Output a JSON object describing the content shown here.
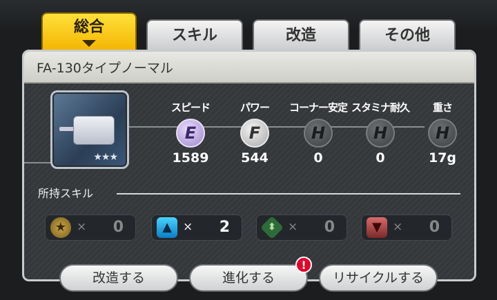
{
  "tabs": [
    {
      "label": "総合",
      "active": true
    },
    {
      "label": "スキル",
      "active": false
    },
    {
      "label": "改造",
      "active": false
    },
    {
      "label": "その他",
      "active": false
    }
  ],
  "part": {
    "name": "FA-130タイプノーマル",
    "rarity_stars": "★★★"
  },
  "stats": [
    {
      "label": "スピード",
      "grade": "E",
      "value": "1589"
    },
    {
      "label": "パワー",
      "grade": "F",
      "value": "544"
    },
    {
      "label": "コーナー安定",
      "grade": "H",
      "value": "0"
    },
    {
      "label": "スタミナ耐久",
      "grade": "H",
      "value": "0"
    },
    {
      "label": "重さ",
      "grade": "H",
      "value": "17g"
    }
  ],
  "skills": {
    "heading": "所持スキル",
    "items": [
      {
        "icon": "star-icon",
        "times": "×",
        "count": "0"
      },
      {
        "icon": "up-arrow-icon",
        "times": "×",
        "count": "2"
      },
      {
        "icon": "diamond-arrow-icon",
        "times": "×",
        "count": "0"
      },
      {
        "icon": "down-arrow-icon",
        "times": "×",
        "count": "0"
      }
    ]
  },
  "buttons": {
    "modify": "改造する",
    "evolve": "進化する",
    "recycle": "リサイクルする",
    "evolve_alert": "!"
  },
  "colors": {
    "active_tab": "#f3b400",
    "alert": "#e4002b",
    "panel_header": "#e8e8e4"
  }
}
